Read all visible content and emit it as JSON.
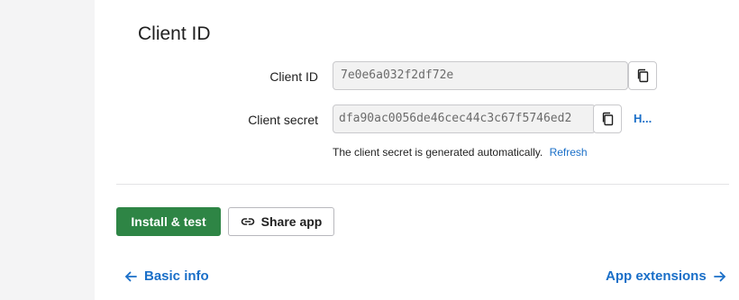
{
  "section": {
    "title": "Client ID"
  },
  "fields": {
    "client_id": {
      "label": "Client ID",
      "value": "7e0e6a032f2df72e"
    },
    "client_secret": {
      "label": "Client secret",
      "value": "dfa90ac0056de46cec44c3c67f5746ed2",
      "help_link": "H...",
      "helper_text": "The client secret is generated automatically.",
      "refresh_label": "Refresh"
    }
  },
  "actions": {
    "install_label": "Install & test",
    "share_label": "Share app"
  },
  "footer_nav": {
    "back_label": "Basic info",
    "next_label": "App extensions"
  },
  "colors": {
    "primary": "#2e8545",
    "link": "#1a6fc8",
    "gutter": "#f4f4f5"
  },
  "icons": {
    "copy": "copy-icon",
    "link": "link-icon",
    "arrow_left": "arrow-left-icon",
    "arrow_right": "arrow-right-icon"
  }
}
